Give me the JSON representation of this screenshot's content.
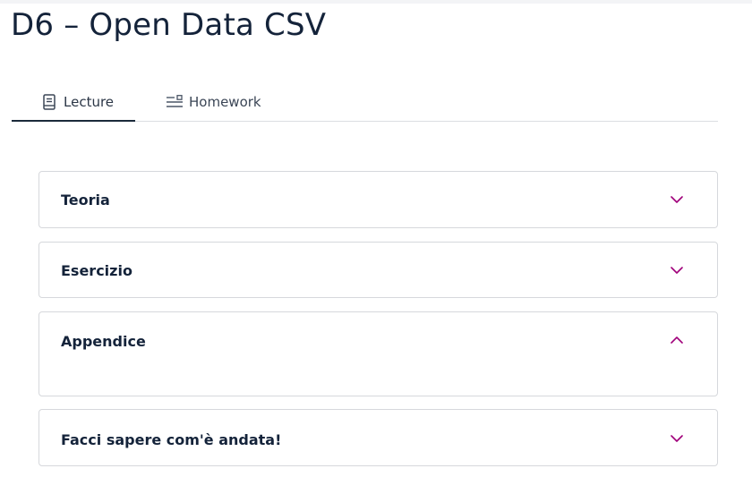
{
  "page": {
    "title": "D6 – Open Data CSV"
  },
  "tabs": [
    {
      "label": "Lecture",
      "icon": "book-icon",
      "active": true
    },
    {
      "label": "Homework",
      "icon": "list-icon",
      "active": false
    }
  ],
  "accordions": [
    {
      "title": "Teoria",
      "expanded": false
    },
    {
      "title": "Esercizio",
      "expanded": false
    },
    {
      "title": "Appendice",
      "expanded": true
    },
    {
      "title": "Facci sapere com'è andata!",
      "expanded": false
    }
  ],
  "colors": {
    "accent": "#a0007a",
    "text": "#14233a",
    "border": "#d6d8dc"
  }
}
